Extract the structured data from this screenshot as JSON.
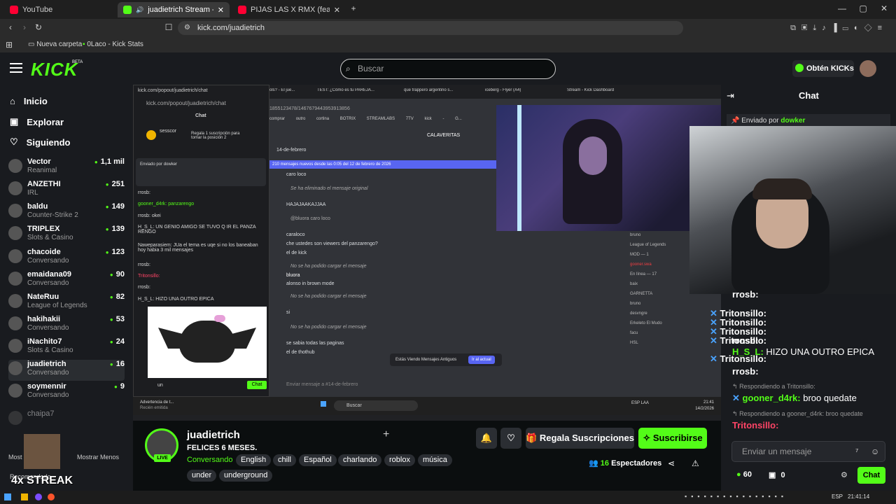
{
  "browser": {
    "tabs": [
      {
        "label": "YouTube",
        "favicon": "youtube-icon"
      },
      {
        "label": "juadietrich Stream - Watch Li",
        "favicon": "kick-icon",
        "active": true
      },
      {
        "label": "PIJAS LAS X RMX (feat. yyy891 & Sha",
        "favicon": "youtube-icon"
      }
    ],
    "url": "kick.com/juadietrich",
    "bookmarks": [
      "Nueva carpeta",
      "0Laco - Kick Stats"
    ]
  },
  "header": {
    "logo": "KICK",
    "beta": "BETA",
    "search_placeholder": "Buscar",
    "get_kicks": "Obtén KICKs"
  },
  "sidebar": {
    "nav": [
      {
        "label": "Inicio",
        "icon": "home-icon"
      },
      {
        "label": "Explorar",
        "icon": "explore-icon"
      },
      {
        "label": "Siguiendo",
        "icon": "heart-icon"
      }
    ],
    "channels": [
      {
        "name": "Vector",
        "category": "Reanimal",
        "viewers": "1,1 mil"
      },
      {
        "name": "ANZETHI",
        "category": "IRL",
        "viewers": "251"
      },
      {
        "name": "baldu",
        "category": "Counter-Strike 2",
        "viewers": "149"
      },
      {
        "name": "TRIPLEX",
        "category": "Slots & Casino",
        "viewers": "139"
      },
      {
        "name": "chacoide",
        "category": "Conversando",
        "viewers": "123"
      },
      {
        "name": "emaidana09",
        "category": "Conversando",
        "viewers": "90"
      },
      {
        "name": "NateRuu",
        "category": "League of Legends",
        "viewers": "82"
      },
      {
        "name": "hakihakii",
        "category": "Conversando",
        "viewers": "53"
      },
      {
        "name": "iNachito7",
        "category": "Slots & Casino",
        "viewers": "24"
      },
      {
        "name": "juadietrich",
        "category": "Conversando",
        "viewers": "16",
        "selected": true
      },
      {
        "name": "soymennir",
        "category": "Conversando",
        "viewers": "9"
      },
      {
        "name": "chaipa7",
        "category": "",
        "viewers": ""
      }
    ],
    "show_more": "Most",
    "show_less": "Mostrar Menos",
    "overlay_text": "4x STREAK",
    "overlay_caption": "Recomendado"
  },
  "stream_overlay": {
    "popout_url": "kick.com/popout/juadietrich/chat",
    "popout_url2": "kick.com/popout/juadietrich/chat",
    "popout_chat_title": "Chat",
    "popout_gift_user": "sesscor",
    "popout_gift_text": "Regala 1 suscripción para tomar la posición 2",
    "popout_pinned": "Enviado por dowker",
    "popout_lines": [
      "rrosb:",
      "gooner_d4rk: panzarengo",
      "rrosb: okei",
      "H_S_L: UN GENIO AMIGO SE TUVO Q IR EL PANZA RENGO",
      "Naweparasiem: JUa el tema es uqe si no los baneaban hoy habia 3 mil mensajes",
      "rrosb:",
      "Tritonsillo:",
      "rrosb:",
      "H_S_L: HIZO UNA OUTRO EPICA"
    ],
    "popout_input": "un",
    "popout_chat_btn": "Chat",
    "discord_tabs": [
      "ols? - El jue...",
      "TEST: ¿Cómo es tu PAREJA...",
      "que trappero argentino s...",
      "iceberg - Flyer (A4)",
      "Stream - Kick Dashboard"
    ],
    "discord_url": "1855123478/1467679443953913856",
    "discord_bookmarks": [
      "comprar",
      "outro",
      "cortina",
      "BOTRIX",
      "STREAMLABS",
      "7TV",
      "kick - G..."
    ],
    "discord_channel": "CALAVERITAS",
    "discord_date": "14-de-febrero",
    "discord_new_msgs": "210 mensajes nuevos desde las 0:05 del 12 de febrero de 2026",
    "discord_msgs": [
      "caro loco",
      "Se ha eliminado el mensaje original",
      "HAJAJAAKAJJAA",
      "@bluora caro loco",
      "caraloco",
      "che ustedes son viewers del panzarengo?",
      "el de kick",
      "No se ha podido cargar el mensaje",
      "bluora",
      "alonso in brown mode",
      "No se ha podido cargar el mensaje",
      "si",
      "No se ha podido cargar el mensaje",
      "se sabia todas las paginas",
      "el de thothub"
    ],
    "discord_old_banner": "Estás Viendo Mensajes Antiguos",
    "discord_jump": "Ir al actual",
    "discord_input": "Enviar mensaje a #14-de-febrero",
    "discord_side": [
      "bruno",
      "League of Legends",
      "MOD — 1",
      "gooner.swa",
      "En línea — 17",
      "baix",
      "GARNETTA",
      "bruno",
      "desvngre",
      "Erkeleto El Mudo",
      "facu",
      "HSL"
    ],
    "taskbar_search": "Buscar",
    "taskbar_lang": "ESP LAA",
    "taskbar_time": "21:41",
    "taskbar_date": "14/2/2026",
    "notif_title": "Advertencia de t...",
    "notif_sub": "Recién emitida"
  },
  "channel": {
    "name": "juadietrich",
    "title": "FELICES 6 MESES.",
    "category": "Conversando",
    "tags": [
      "English",
      "chill",
      "Español",
      "charlando",
      "roblox",
      "música",
      "under",
      "underground"
    ],
    "live": "LIVE",
    "gift_button": "Regala Suscripciones",
    "subscribe_button": "Suscribirse",
    "viewers_count": "16",
    "viewers_label": "Espectadores"
  },
  "chat": {
    "title": "Chat",
    "pinned_by": "Enviado por",
    "pinned_user": "dowker",
    "messages": [
      {
        "user": "rrosb:",
        "text": "",
        "color": "#ffffff"
      },
      {
        "user": "Tritonsillo:",
        "text": "",
        "color": "#ffffff"
      },
      {
        "user": "Tritonsillo:",
        "text": "",
        "color": "#ffffff"
      },
      {
        "user": "Tritonsillo:",
        "text": "",
        "color": "#ffffff"
      },
      {
        "user": "rrosb:",
        "text": "",
        "color": "#ffffff"
      },
      {
        "user": "Tritonsillo:",
        "text": "",
        "color": "#ffffff"
      },
      {
        "user": "H_S_L:",
        "text": "HIZO UNA OUTRO EPICA",
        "color": "#53fc18"
      },
      {
        "user": "Tritonsillo:",
        "text": "",
        "color": "#ffffff"
      },
      {
        "user": "rrosb:",
        "text": "",
        "color": "#ffffff"
      }
    ],
    "reply1_label": "Respondiendo a Tritonsillo:",
    "reply1_user": "gooner_d4rk:",
    "reply1_text": "broo quedate",
    "reply2_label": "Respondiendo a gooner_d4rk: broo quedate",
    "reply2_user": "Tritonsillo:",
    "input_placeholder": "Enviar un mensaje",
    "kicks_count": "60",
    "gift_count": "0",
    "send_button": "Chat"
  },
  "system": {
    "lang": "ESP",
    "time": "21:41:14"
  },
  "colors": {
    "accent": "#53fc18",
    "background": "#0b0e0f",
    "panel": "#191b1f"
  }
}
